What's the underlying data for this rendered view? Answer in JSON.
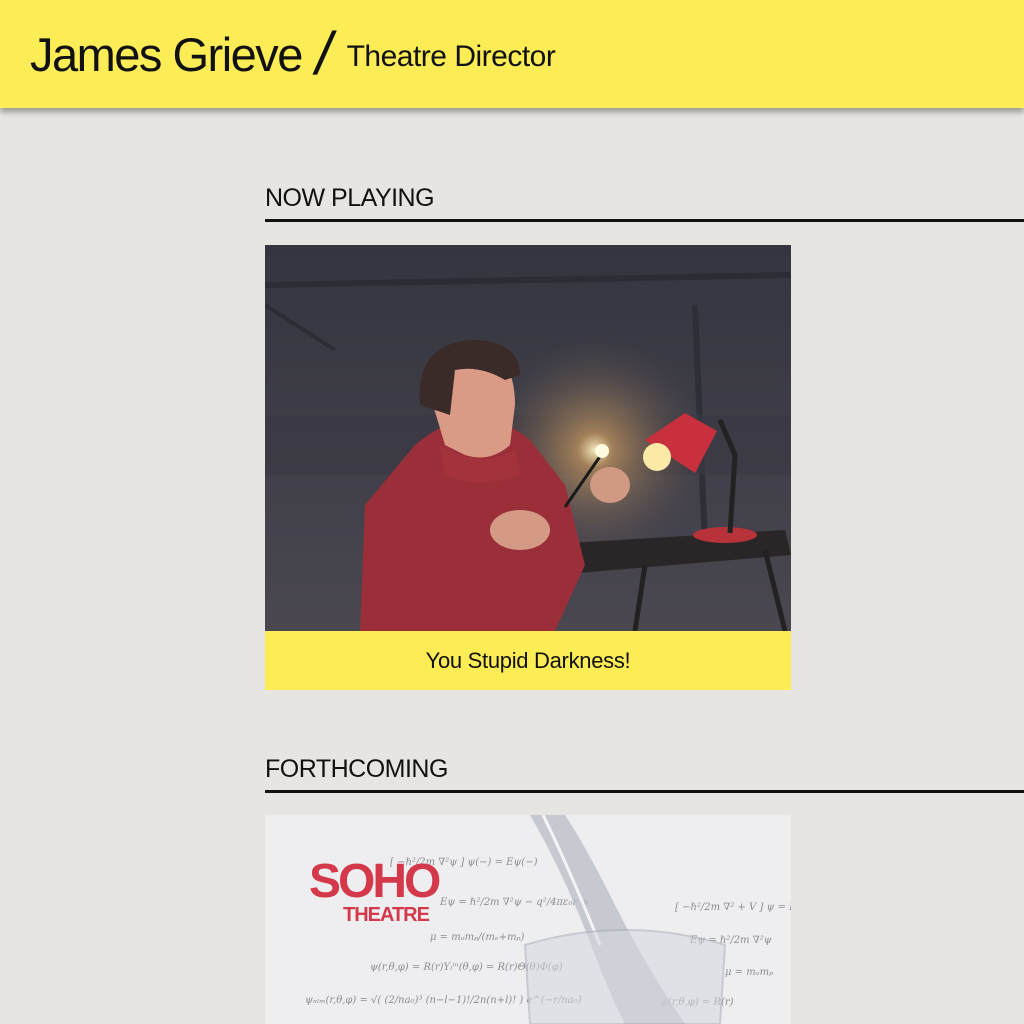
{
  "header": {
    "name": "James Grieve",
    "separator": "/",
    "role": "Theatre Director"
  },
  "sections": {
    "now_playing": {
      "heading": "NOW PLAYING",
      "show_title": "You Stupid Darkness!"
    },
    "forthcoming": {
      "heading": "FORTHCOMING",
      "venue_logo_line1": "SOHO",
      "venue_logo_line2": "THEATRE"
    }
  },
  "colors": {
    "accent_yellow": "#fcec55",
    "background": "#e7e5e1",
    "logo_red": "#d4394b"
  }
}
